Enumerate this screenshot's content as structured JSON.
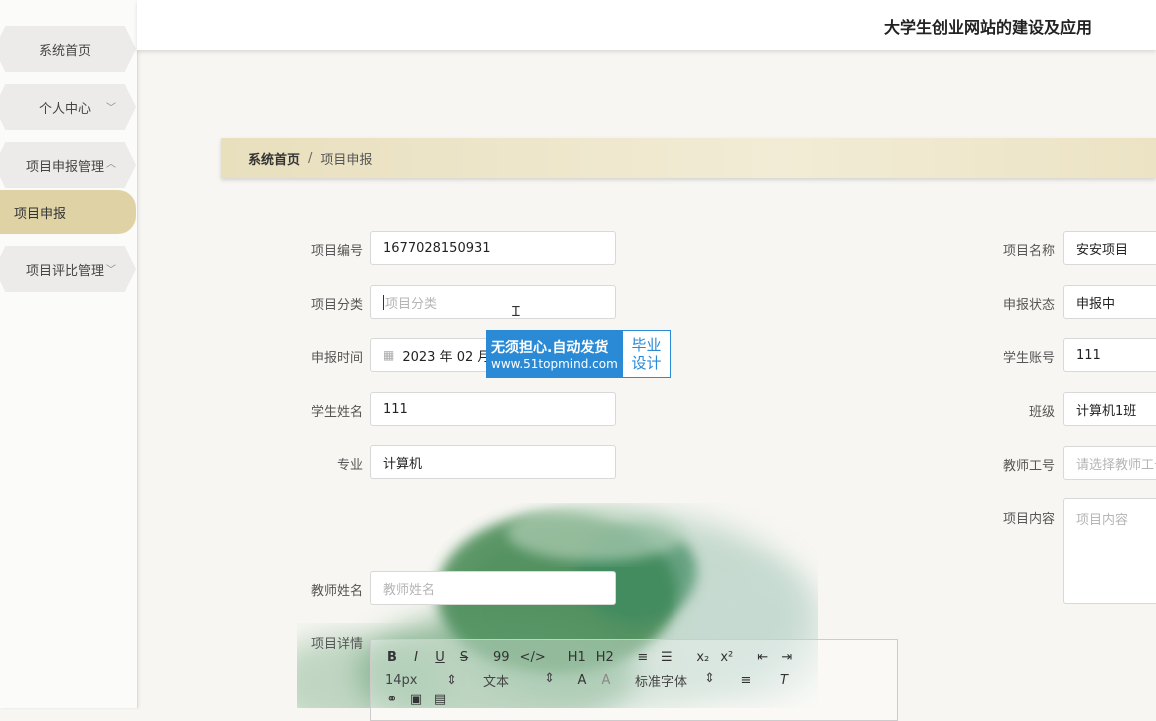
{
  "sidebar": {
    "items": [
      {
        "label": "系统首页"
      },
      {
        "label": "个人中心"
      },
      {
        "label": "项目申报管理"
      },
      {
        "label": "项目评比管理"
      }
    ],
    "active_sub": "项目申报"
  },
  "header": {
    "title": "大学生创业网站的建设及应用"
  },
  "breadcrumb": {
    "home": "系统首页",
    "sep": "/",
    "current": "项目申报"
  },
  "form": {
    "project_no": {
      "label": "项目编号",
      "value": "1677028150931"
    },
    "project_category": {
      "label": "项目分类",
      "placeholder": "项目分类"
    },
    "apply_time": {
      "label": "申报时间",
      "value": "2023 年 02 月 2"
    },
    "student_name": {
      "label": "学生姓名",
      "value": "111"
    },
    "major": {
      "label": "专业",
      "value": "计算机"
    },
    "teacher_name": {
      "label": "教师姓名",
      "placeholder": "教师姓名"
    },
    "project_detail": {
      "label": "项目详情"
    },
    "project_name": {
      "label": "项目名称",
      "value": "安安项目"
    },
    "apply_status": {
      "label": "申报状态",
      "value": "申报中"
    },
    "student_account": {
      "label": "学生账号",
      "value": "111"
    },
    "class": {
      "label": "班级",
      "value": "计算机1班"
    },
    "teacher_no": {
      "label": "教师工号",
      "placeholder": "请选择教师工号"
    },
    "project_content": {
      "label": "项目内容",
      "placeholder": "项目内容"
    }
  },
  "editor": {
    "row1": [
      "B",
      "I",
      "U",
      "S",
      "99",
      "</>",
      "H1",
      "H2",
      "≡",
      "☰",
      "x₂",
      "x²",
      "⇤",
      "⇥"
    ],
    "font_size": "14px",
    "text_type": "文本",
    "font_family": "标准字体"
  },
  "watermark": {
    "line1": "无须担心.自动发货",
    "line2": "www.51topmind.com",
    "right1": "毕业",
    "right2": "设计"
  },
  "colors": {
    "active_menu": "#dfd3a6",
    "breadcrumb_bg": "#e8dfbd",
    "watermark_blue": "#2a8ad6"
  }
}
